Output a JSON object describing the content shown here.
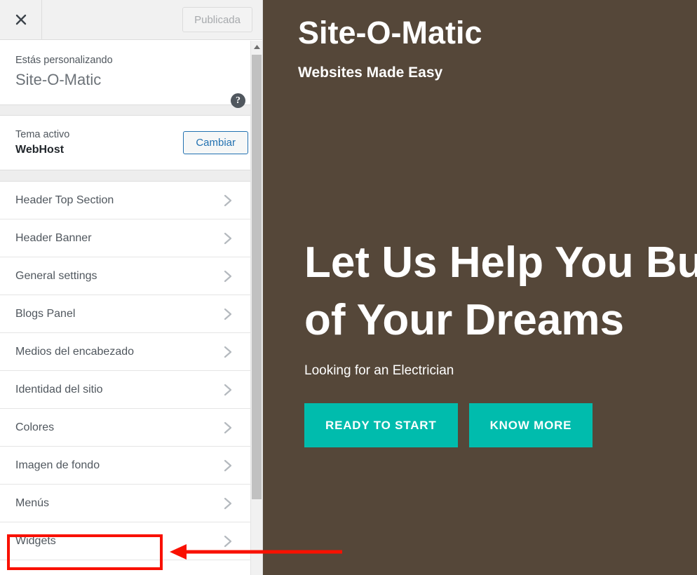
{
  "customizer": {
    "header": {
      "close_label": "close-icon",
      "publish_label": "Publicada"
    },
    "customizing": {
      "eyebrow": "Estás personalizando",
      "site_name": "Site-O-Matic",
      "help_label": "?"
    },
    "theme": {
      "label": "Tema activo",
      "name": "WebHost",
      "change_label": "Cambiar"
    },
    "sections": [
      {
        "label": "Header Top Section"
      },
      {
        "label": "Header Banner"
      },
      {
        "label": "General settings"
      },
      {
        "label": "Blogs Panel"
      },
      {
        "label": "Medios del encabezado"
      },
      {
        "label": "Identidad del sitio"
      },
      {
        "label": "Colores"
      },
      {
        "label": "Imagen de fondo"
      },
      {
        "label": "Menús"
      },
      {
        "label": "Widgets"
      }
    ]
  },
  "preview": {
    "site_title": "Site-O-Matic",
    "tagline": "Websites Made Easy",
    "hero_heading_line1": "Let Us Help You Build the Website",
    "hero_heading_line2": "of Your Dreams",
    "hero_subtext": "Looking for an Electrician",
    "cta_primary": "READY TO START",
    "cta_secondary": "KNOW MORE"
  },
  "colors": {
    "preview_background": "#554739",
    "cta_teal": "#00bcad",
    "annotation_red": "#f91000",
    "link_blue": "#2271b1"
  }
}
